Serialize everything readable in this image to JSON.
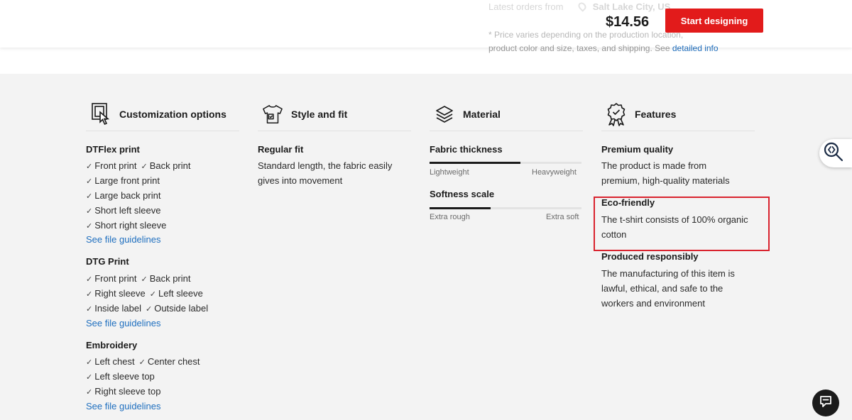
{
  "top": {
    "latest_orders_label": "Latest orders from",
    "latest_orders_city": "Salt Lake City, US",
    "note_line1": "* Price varies depending on the production location,",
    "note_line2": "product color and size, taxes, and shipping. See",
    "note_link": "detailed info"
  },
  "sticky": {
    "price": "$14.56",
    "cta_label": "Start designing"
  },
  "customization": {
    "title": "Customization options",
    "icon": "customize-cursor-icon",
    "dtflex": {
      "title": "DTFlex print",
      "rows": [
        [
          "Front print",
          "Back print"
        ],
        [
          "Large front print"
        ],
        [
          "Large back print"
        ],
        [
          "Short left sleeve"
        ],
        [
          "Short right sleeve"
        ]
      ],
      "link": "See file guidelines"
    },
    "dtg": {
      "title": "DTG Print",
      "rows": [
        [
          "Front print",
          "Back print"
        ],
        [
          "Right sleeve",
          "Left sleeve"
        ],
        [
          "Inside label",
          "Outside label"
        ]
      ],
      "link": "See file guidelines"
    },
    "embroidery": {
      "title": "Embroidery",
      "rows": [
        [
          "Left chest",
          "Center chest"
        ],
        [
          "Left sleeve top"
        ],
        [
          "Right sleeve top"
        ]
      ],
      "link": "See file guidelines"
    }
  },
  "style": {
    "title": "Style and fit",
    "icon": "tshirt-icon",
    "fit_title": "Regular fit",
    "fit_lines": [
      "Standard length, the fabric easily",
      "gives into movement"
    ]
  },
  "material": {
    "title": "Material",
    "icon": "layers-icon",
    "thickness": {
      "title": "Fabric thickness",
      "min_label": "Lightweight",
      "max_label": "Heavyweight",
      "level": 0.6
    },
    "softness": {
      "title": "Softness scale",
      "min_label": "Extra rough",
      "max_label": "Extra soft",
      "level": 0.4
    }
  },
  "features": {
    "title": "Features",
    "icon": "award-badge-icon",
    "items": [
      {
        "title": "Premium quality",
        "lines": [
          "The product is made from",
          "premium, high-quality materials"
        ]
      },
      {
        "title": "Eco-friendly",
        "lines": [
          "The t-shirt consists of 100% organic",
          "cotton"
        ]
      },
      {
        "title": "Produced responsibly",
        "lines": [
          "The manufacturing of this item is",
          "lawful, ethical, and safe to the",
          "workers and environment"
        ]
      }
    ]
  },
  "colors": {
    "accent": "#e21b1b",
    "link": "#1f6fbf",
    "highlight": "#d9232e"
  }
}
